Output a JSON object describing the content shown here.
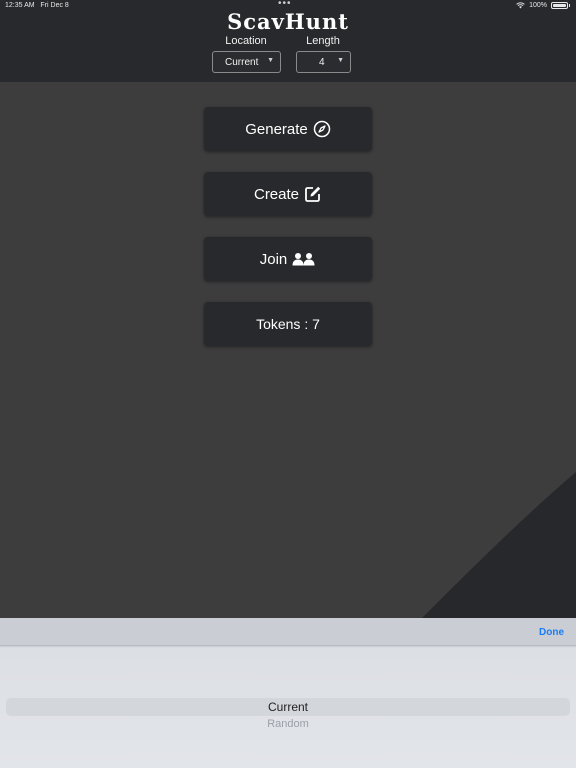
{
  "status_bar": {
    "time": "12:35 AM",
    "date": "Fri Dec 8",
    "dots": "•••",
    "battery": "100%"
  },
  "header": {
    "title": "ScavHunt",
    "location": {
      "label": "Location",
      "value": "Current"
    },
    "length": {
      "label": "Length",
      "value": "4"
    }
  },
  "menu": {
    "generate": "Generate",
    "create": "Create",
    "join": "Join",
    "tokens": "Tokens : 7"
  },
  "picker": {
    "done_label": "Done",
    "options": [
      "Current",
      "Random"
    ],
    "selected": "Current"
  },
  "icons": [
    "compass-icon",
    "edit-icon",
    "users-icon",
    "wifi-icon",
    "battery-icon",
    "caret-down-icon"
  ],
  "colors": {
    "header_bg": "#28292c",
    "body_bg": "#3d3d3e",
    "button_bg": "#28292c",
    "accent": "#1a7cf5"
  }
}
